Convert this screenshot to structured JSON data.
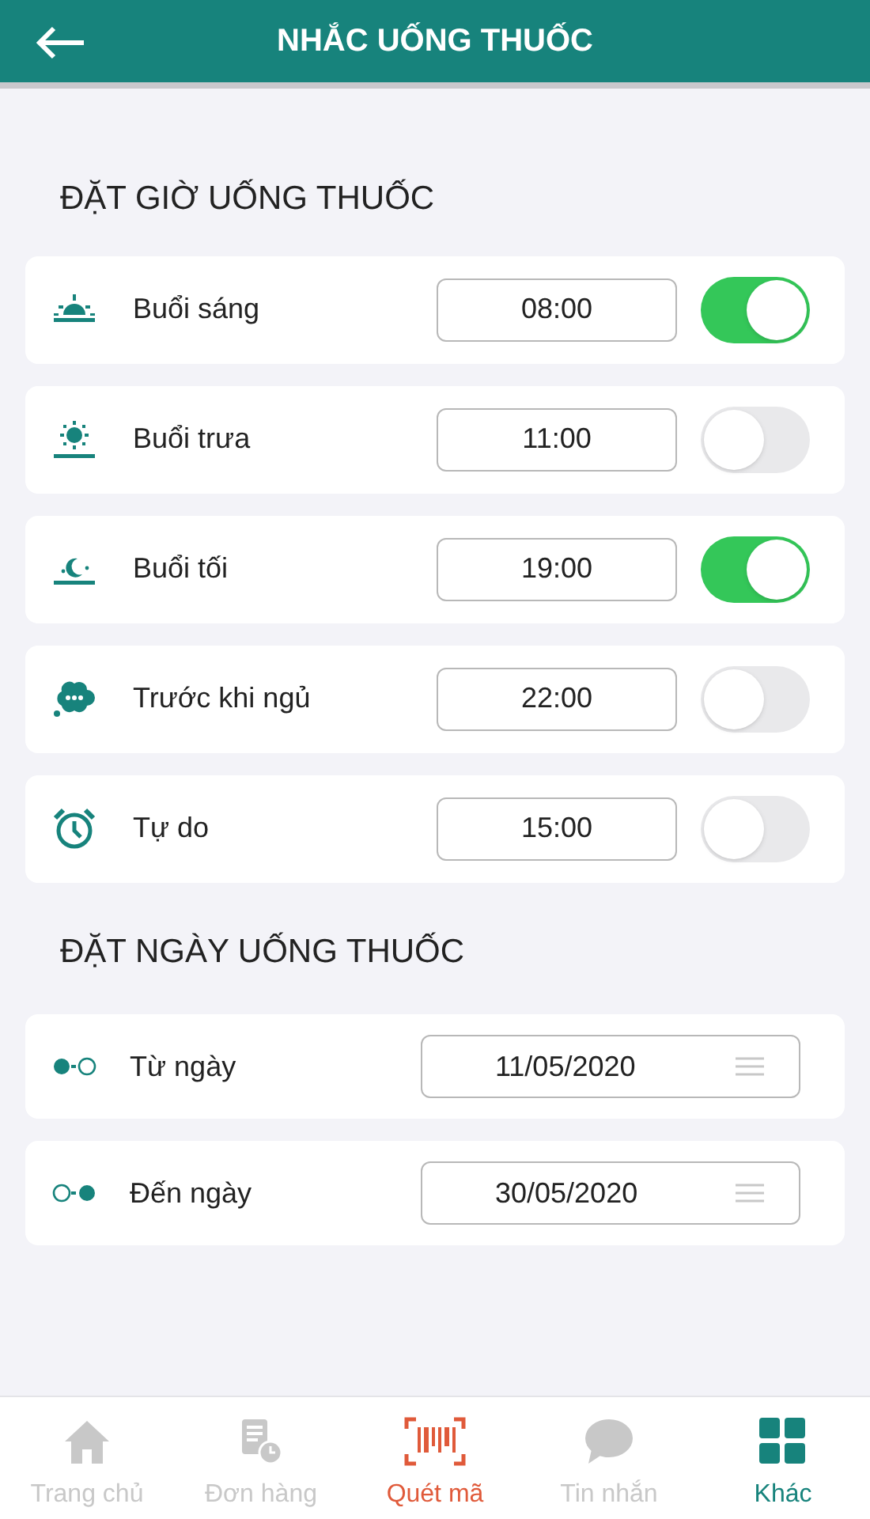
{
  "header": {
    "title": "NHẮC UỐNG THUỐC"
  },
  "time_section": {
    "title": "ĐẶT GIỜ UỐNG THUỐC",
    "rows": [
      {
        "kind": "sunrise",
        "label": "Buổi sáng",
        "time": "08:00",
        "on": true
      },
      {
        "kind": "sun",
        "label": "Buổi trưa",
        "time": "11:00",
        "on": false
      },
      {
        "kind": "moon",
        "label": "Buổi tối",
        "time": "19:00",
        "on": true
      },
      {
        "kind": "sleep",
        "label": "Trước khi ngủ",
        "time": "22:00",
        "on": false
      },
      {
        "kind": "alarm",
        "label": "Tự do",
        "time": "15:00",
        "on": false
      }
    ]
  },
  "date_section": {
    "title": "ĐẶT NGÀY UỐNG THUỐC",
    "rows": [
      {
        "kind": "start",
        "label": "Từ ngày",
        "date": "11/05/2020"
      },
      {
        "kind": "end",
        "label": "Đến ngày",
        "date": "30/05/2020"
      }
    ]
  },
  "tab_bar": [
    {
      "kind": "home",
      "label": "Trang chủ",
      "selected": false
    },
    {
      "kind": "orders",
      "label": "Đơn hàng",
      "selected": false
    },
    {
      "kind": "scan",
      "label": "Quét mã",
      "selected": false
    },
    {
      "kind": "chat",
      "label": "Tin nhắn",
      "selected": false
    },
    {
      "kind": "grid",
      "label": "Khác",
      "selected": true
    }
  ]
}
